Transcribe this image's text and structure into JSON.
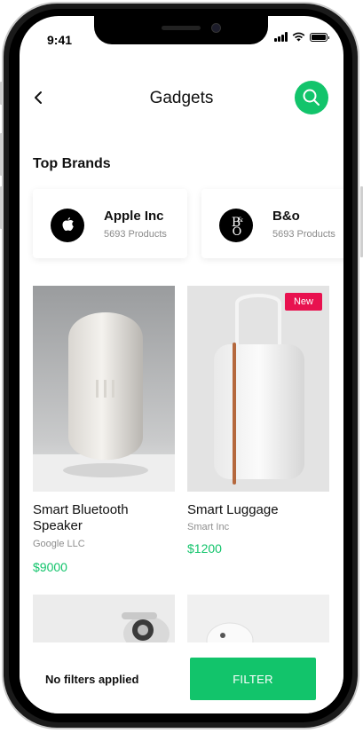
{
  "status_bar": {
    "time": "9:41"
  },
  "header": {
    "title": "Gadgets",
    "back_icon": "chevron-left-icon",
    "search_icon": "search-icon"
  },
  "colors": {
    "accent": "#12c46b",
    "badge": "#e8114f"
  },
  "top_brands": {
    "title": "Top Brands",
    "items": [
      {
        "name": "Apple Inc",
        "products": "5693 Products",
        "logo_icon": "apple-logo-icon"
      },
      {
        "name": "B&o",
        "products": "5693 Products",
        "logo_icon": "bo-logo-icon"
      }
    ]
  },
  "products": [
    {
      "name": "Smart Bluetooth Speaker",
      "brand": "Google LLC",
      "price": "$9000",
      "badge": ""
    },
    {
      "name": "Smart Luggage",
      "brand": "Smart Inc",
      "price": "$1200",
      "badge": "New"
    }
  ],
  "bottom_bar": {
    "filter_status": "No filters applied",
    "filter_label": "FILTER"
  }
}
